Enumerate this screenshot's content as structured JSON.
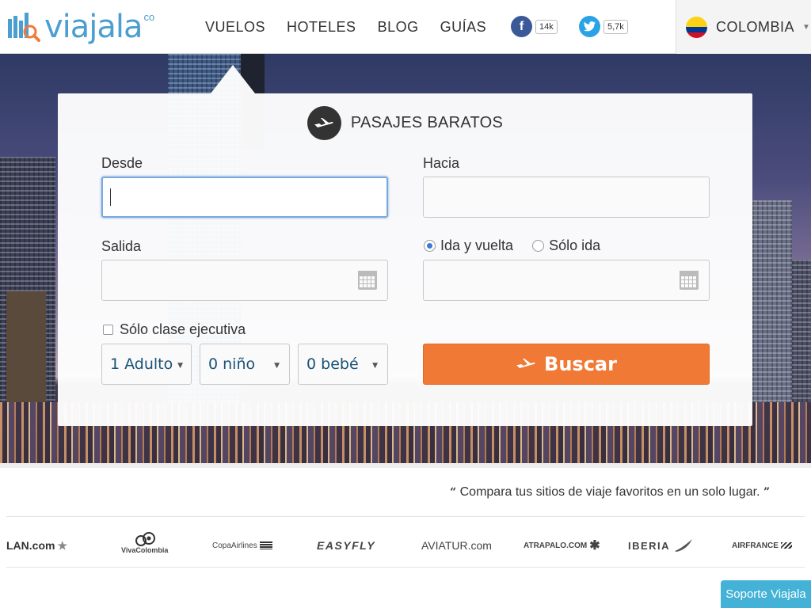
{
  "header": {
    "logo_text": "viajala",
    "logo_suffix": "co",
    "nav": [
      "VUELOS",
      "HOTELES",
      "BLOG",
      "GUÍAS"
    ],
    "facebook_count": "14k",
    "twitter_count": "5,7k",
    "country": "COLOMBIA"
  },
  "search": {
    "title": "PASAJES BARATOS",
    "from_label": "Desde",
    "to_label": "Hacia",
    "from_value": "",
    "to_value": "",
    "depart_label": "Salida",
    "trip_type": {
      "options": [
        "Ida y vuelta",
        "Sólo ida"
      ],
      "selected": "Ida y vuelta"
    },
    "business_class_label": "Sólo clase ejecutiva",
    "business_class_checked": false,
    "adults": "1 Adulto",
    "children": "0 niño",
    "infants": "0 bebé",
    "submit_label": "Buscar"
  },
  "tagline": "Compara tus sitios de viaje favoritos en un solo lugar.",
  "partners": [
    "LAN.com",
    "VivaColombia",
    "CopaAirlines",
    "EASYFLY",
    "AVIATUR.com",
    "ATRAPALO.COM",
    "IBERIA",
    "AIRFRANCE"
  ],
  "support_label": "Soporte Viajala",
  "colors": {
    "brand_blue": "#4a9fd0",
    "brand_orange": "#f07935",
    "support_teal": "#44b2d6"
  }
}
